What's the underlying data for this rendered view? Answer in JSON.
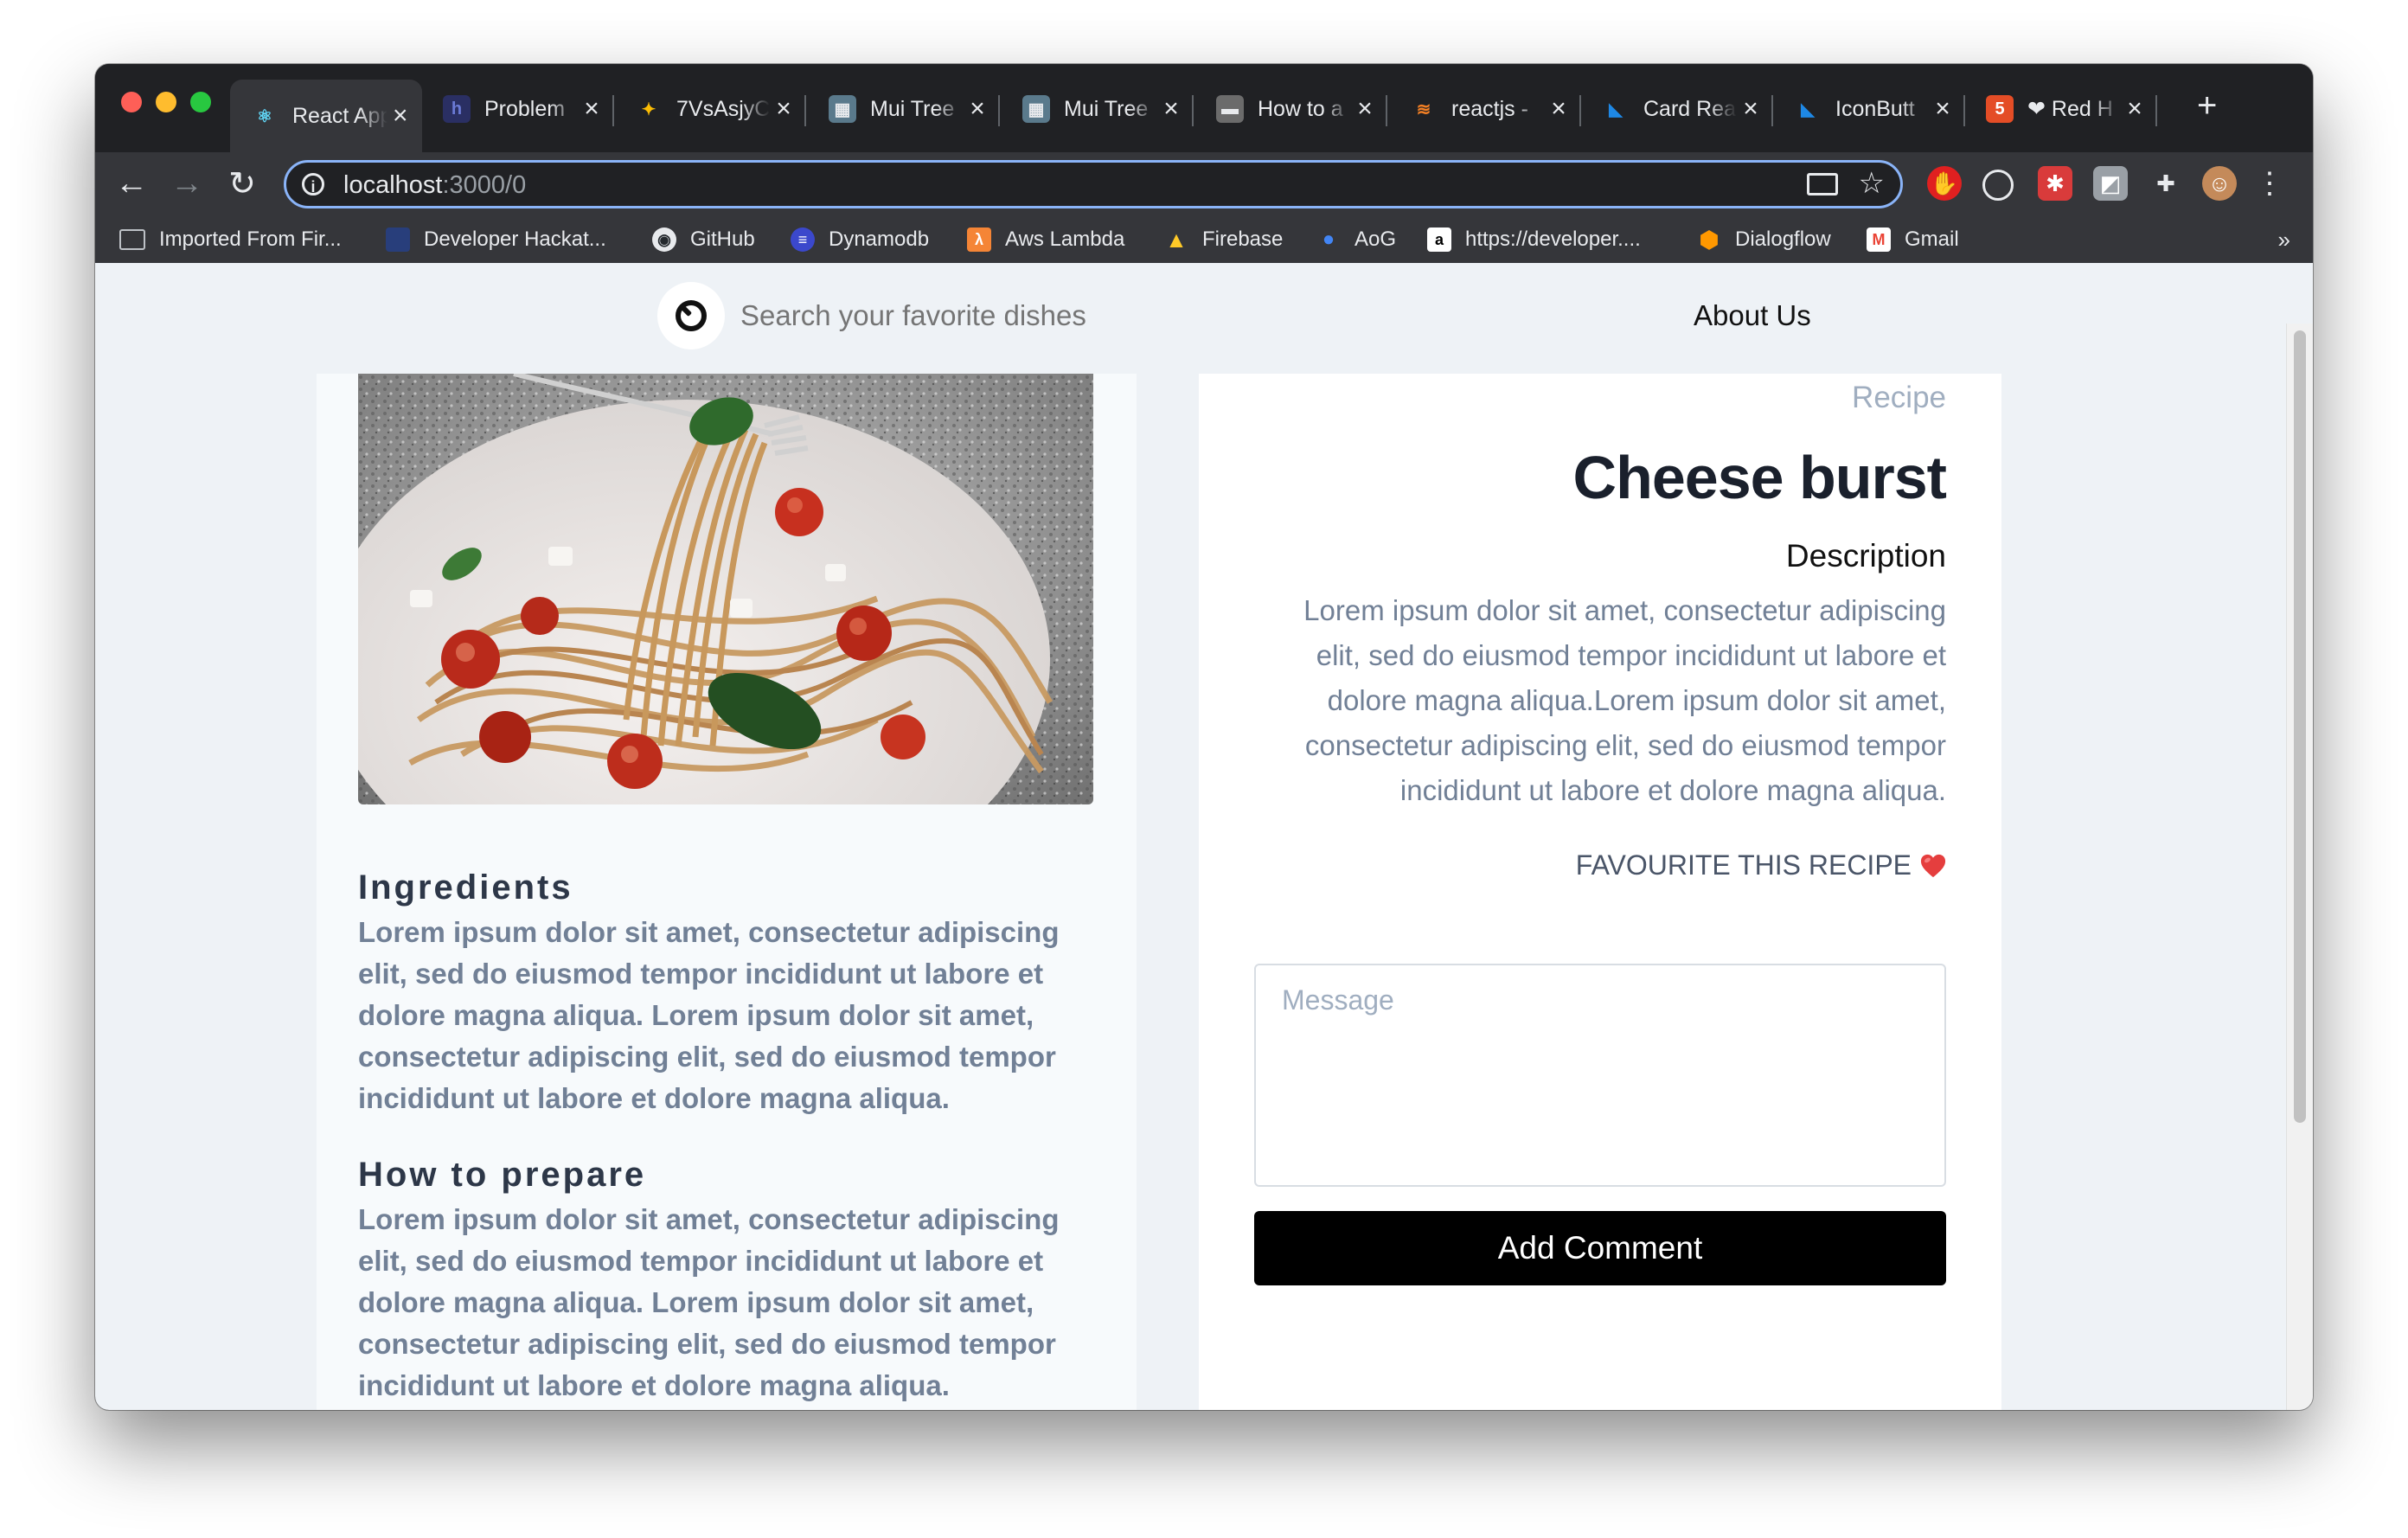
{
  "browser": {
    "tabs": [
      {
        "label": "React App",
        "favicon": "react-icon",
        "active": true
      },
      {
        "label": "Problem",
        "favicon": "hackerearth-icon"
      },
      {
        "label": "7VsAsjyC",
        "favicon": "pinwheel-icon"
      },
      {
        "label": "Mui Tree",
        "favicon": "mui-tree-icon"
      },
      {
        "label": "Mui Tree",
        "favicon": "mui-tree-icon"
      },
      {
        "label": "How to a",
        "favicon": "video-icon"
      },
      {
        "label": "reactjs -",
        "favicon": "stackoverflow-icon"
      },
      {
        "label": "Card Rea",
        "favicon": "mui-icon"
      },
      {
        "label": "IconButt",
        "favicon": "mui-icon"
      },
      {
        "label": "❤ Red H",
        "favicon": "html5-icon"
      }
    ],
    "url": {
      "host": "localhost",
      "path": ":3000/0"
    },
    "bookmarks": [
      {
        "label": "Imported From Fir...",
        "icon": "folder-icon"
      },
      {
        "label": "Developer Hackat...",
        "icon": "devpost-icon"
      },
      {
        "label": "GitHub",
        "icon": "github-icon"
      },
      {
        "label": "Dynamodb",
        "icon": "dynamodb-icon"
      },
      {
        "label": "Aws Lambda",
        "icon": "lambda-icon"
      },
      {
        "label": "Firebase",
        "icon": "firebase-icon"
      },
      {
        "label": "AoG",
        "icon": "assistant-icon"
      },
      {
        "label": "https://developer....",
        "icon": "amazon-icon"
      },
      {
        "label": "Dialogflow",
        "icon": "dialogflow-icon"
      },
      {
        "label": "Gmail",
        "icon": "gmail-icon"
      }
    ],
    "more_bookmarks": "»"
  },
  "header": {
    "search_placeholder": "Search your favorite dishes",
    "about": "About Us"
  },
  "recipe": {
    "label": "Recipe",
    "title": "Cheese burst",
    "description_heading": "Description",
    "description": "Lorem ipsum dolor sit amet, consectetur adipiscing elit, sed do eiusmod tempor incididunt ut labore et dolore magna aliqua.Lorem ipsum dolor sit amet, consectetur adipiscing elit, sed do eiusmod tempor incididunt ut labore et dolore magna aliqua.",
    "favourite": "FAVOURITE THIS RECIPE",
    "ingredients_heading": "Ingredients",
    "ingredients": "Lorem ipsum dolor sit amet, consectetur adipiscing elit, sed do eiusmod tempor incididunt ut labore et dolore magna aliqua. Lorem ipsum dolor sit amet, consectetur adipiscing elit, sed do eiusmod tempor incididunt ut labore et dolore magna aliqua.",
    "prepare_heading": "How to prepare",
    "prepare": "Lorem ipsum dolor sit amet, consectetur adipiscing elit, sed do eiusmod tempor incididunt ut labore et dolore magna aliqua. Lorem ipsum dolor sit amet, consectetur adipiscing elit, sed do eiusmod tempor incididunt ut labore et dolore magna aliqua."
  },
  "comment": {
    "placeholder": "Message",
    "button": "Add Comment"
  },
  "colors": {
    "page_bg": "#eef2f6",
    "button_bg": "#000000",
    "muted_text": "#718096",
    "heart": "#e53e3e"
  }
}
